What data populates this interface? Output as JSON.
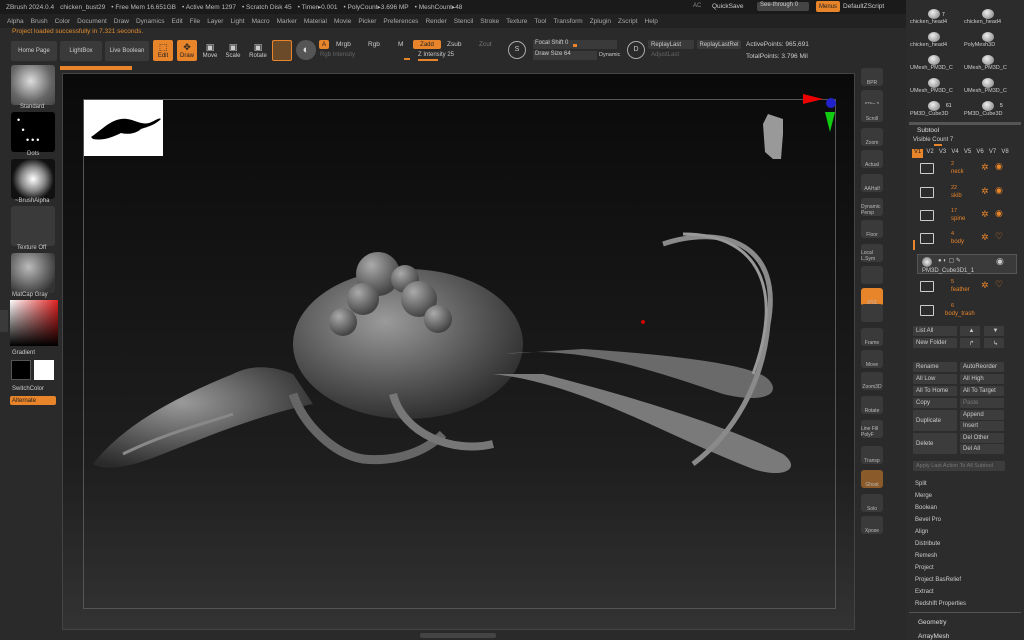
{
  "titlebar": {
    "app": "ZBrush 2024.0.4",
    "file": "chicken_bust29",
    "free_mem": "• Free Mem 16.651GB",
    "active_mem": "• Active Mem 1297",
    "scratch": "• Scratch Disk 45",
    "timer": "• Timer▸0.001",
    "polycount": "• PolyCount▸3.696 MP",
    "meshcount": "• MeshCount▸48",
    "ac": "AC",
    "quicksave": "QuickSave",
    "seethrough": "See-through",
    "seethrough_val": "0",
    "menus": "Menus",
    "script": "DefaultZScript"
  },
  "menubar": [
    "Alpha",
    "Brush",
    "Color",
    "Document",
    "Draw",
    "Dynamics",
    "Edit",
    "File",
    "Layer",
    "Light",
    "Macro",
    "Marker",
    "Material",
    "Movie",
    "Picker",
    "Preferences",
    "Render",
    "Stencil",
    "Stroke",
    "Texture",
    "Tool",
    "Transform",
    "Zplugin",
    "Zscript",
    "Help"
  ],
  "status_message": "Project loaded successfully in 7.321 seconds.",
  "toolbar": {
    "home": "Home Page",
    "lightbox": "LightBox",
    "liveboolean": "Live Boolean",
    "edit": "Edit",
    "draw": "Draw",
    "move": "Move",
    "scale": "Scale",
    "rotate": "Rotate",
    "a": "A",
    "mrgb": "Mrgb",
    "rgb": "Rgb",
    "m": "M",
    "zadd": "Zadd",
    "zsub": "Zsub",
    "zcut": "Zcut",
    "rgb_intensity": "Rgb Intensity",
    "z_intensity": "Z Intensity 25",
    "z_intensity_value": 25,
    "focal_shift": "Focal Shift 0",
    "draw_size": "Draw Size 64",
    "dynamic": "Dynamic",
    "replaylast": "ReplayLast",
    "replaylastrel": "ReplayLastRel",
    "adjustlast": "AdjustLast",
    "active_points": "ActivePoints: 965,691",
    "total_points": "TotalPoints: 3.796 Mil"
  },
  "leftpanel": {
    "standard": "Standard",
    "dots": "Dots",
    "brushalpha": "~BrushAlpha",
    "textureoff": "Texture Off",
    "matcap": "MatCap Gray",
    "gradient": "Gradient",
    "switchcolor": "SwitchColor",
    "alternate": "Alternate"
  },
  "shelf": [
    "BPR",
    "SPix 3",
    "Scroll",
    "Zoom",
    "Actual",
    "AAHalf",
    "Dynamic Persp",
    "Floor",
    "Local L.Sym",
    "",
    "XYZ",
    "",
    "Frame",
    "Move",
    "Zoom3D",
    "Rotate",
    "Line Fill PolyF",
    "Transp",
    "Ghost",
    "Solo",
    "Xpose"
  ],
  "toolthumbs": [
    "chicken_head4",
    "chicken_head4",
    "chicken_head4",
    "PolyMesh3D",
    "UMesh_PM3D_C",
    "UMesh_PM3D_C",
    "UMesh_PM3D_C",
    "UMesh_PM3D_C",
    "PM3D_Cube3D",
    "PM3D_Cube3D"
  ],
  "thumbcounts": [
    "7",
    "61",
    "5"
  ],
  "subtool": {
    "title": "Subtool",
    "visible_count": "Visible Count 7",
    "tabs": [
      "V1",
      "V2",
      "V3",
      "V4",
      "V5",
      "V6",
      "V7",
      "V8"
    ],
    "items": [
      {
        "count": "2",
        "name": "neck"
      },
      {
        "count": "22",
        "name": "skib"
      },
      {
        "count": "17",
        "name": "spine"
      },
      {
        "count": "4",
        "name": "body"
      },
      {
        "count": "",
        "name": "PM3D_Cube3D1_1"
      },
      {
        "count": "5",
        "name": "feather"
      },
      {
        "count": "6",
        "name": "body_trash"
      }
    ],
    "buttons": {
      "listall": "List All",
      "newfolder": "New Folder",
      "rename": "Rename",
      "autoreorder": "AutoReorder",
      "alllow": "All Low",
      "allhigh": "All High",
      "alltohome": "All To Home",
      "alltotarget": "All To Target",
      "copy": "Copy",
      "paste": "Paste",
      "duplicate": "Duplicate",
      "append": "Append",
      "insert": "Insert",
      "delete": "Delete",
      "delother": "Del Other",
      "delall": "Del All",
      "applylast": "Apply Last Action To All Subtool"
    }
  },
  "actions": [
    "Split",
    "Merge",
    "Boolean",
    "Bevel Pro",
    "Align",
    "Distribute",
    "Remesh",
    "Project",
    "Project BasRelief",
    "Extract",
    "Redshift Properties"
  ],
  "geometry": "Geometry",
  "arraymesh": "ArrayMesh",
  "colors": {
    "accent": "#e8842a",
    "panel": "#2c2c2c",
    "viewport": "#111111"
  }
}
